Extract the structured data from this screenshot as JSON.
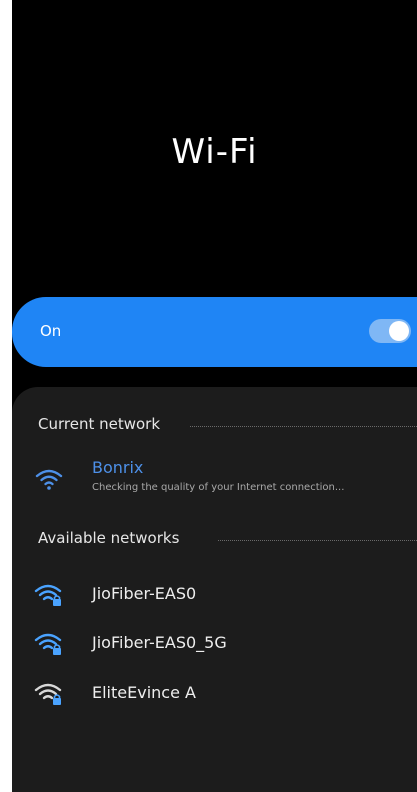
{
  "page": {
    "title": "Wi-Fi"
  },
  "toggle": {
    "label": "On",
    "state": true
  },
  "current_network": {
    "header": "Current network",
    "name": "Bonrix",
    "status": "Checking the quality of your Internet connection..."
  },
  "available_networks": {
    "header": "Available networks",
    "items": [
      {
        "name": "JioFiber-EAS0"
      },
      {
        "name": "JioFiber-EAS0_5G"
      },
      {
        "name": "EliteEvince A"
      }
    ]
  },
  "colors": {
    "accent": "#1f85f5",
    "current_network": "#4d90e8",
    "secured_icon": "#4aa3ff",
    "panel_bg": "#1c1c1c"
  }
}
